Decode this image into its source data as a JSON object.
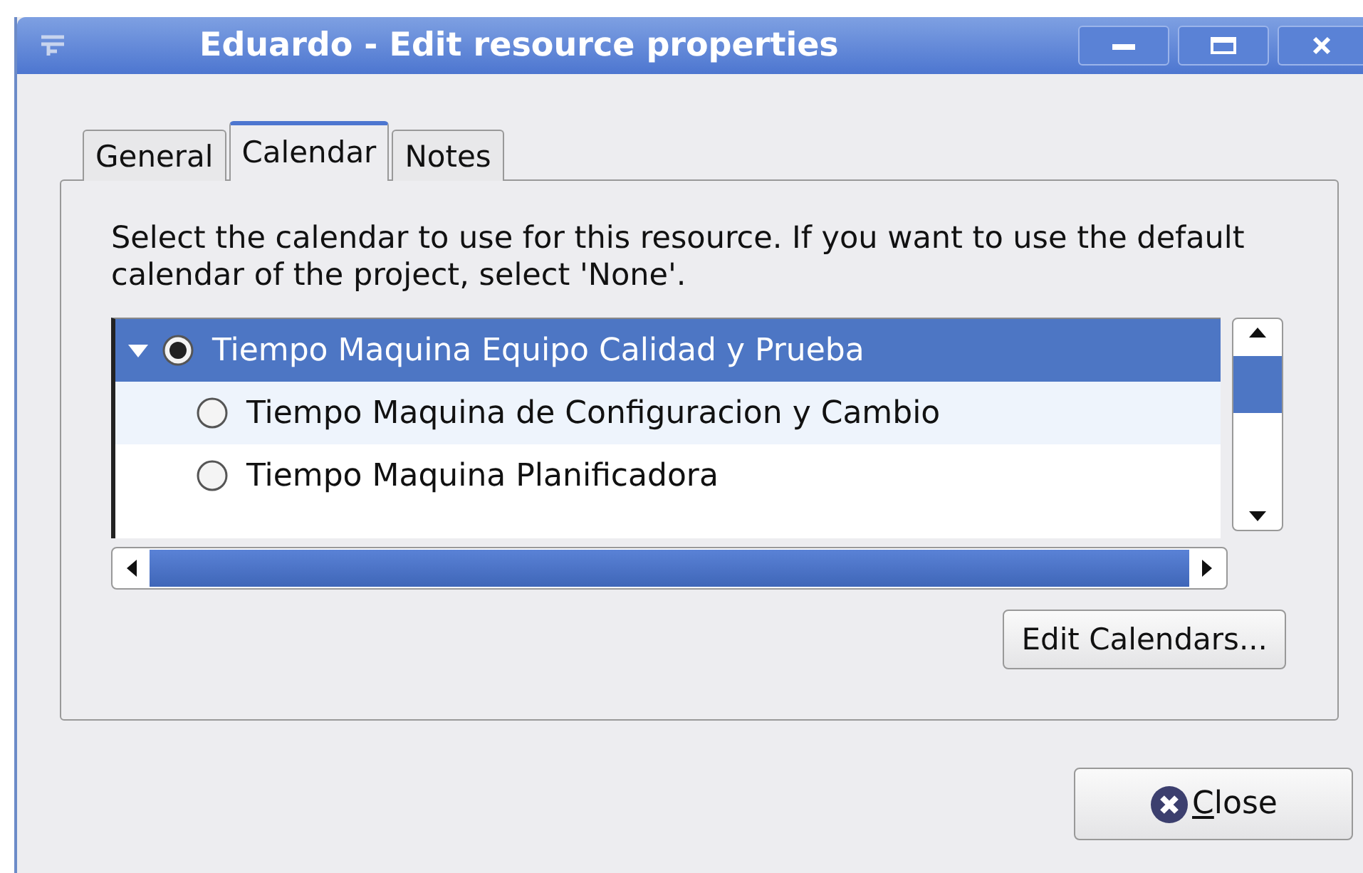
{
  "window": {
    "title": "Eduardo - Edit resource properties"
  },
  "tabs": [
    {
      "label": "General",
      "selected": false
    },
    {
      "label": "Calendar",
      "selected": true
    },
    {
      "label": "Notes",
      "selected": false
    }
  ],
  "instructions": "Select the calendar to use for this resource. If you want to use the default calendar of the project, select 'None'.",
  "calendar_tree": [
    {
      "label": "Tiempo Maquina Equipo Calidad y Prueba",
      "checked": true,
      "selected": true,
      "expanded": true,
      "children": [
        {
          "label": "Tiempo Maquina de Configuracion y Cambio",
          "checked": false,
          "selected": false
        },
        {
          "label": "Tiempo Maquina Planificadora",
          "checked": false,
          "selected": false
        }
      ]
    }
  ],
  "edit_button": "Edit Calendars...",
  "close_button": "Close"
}
